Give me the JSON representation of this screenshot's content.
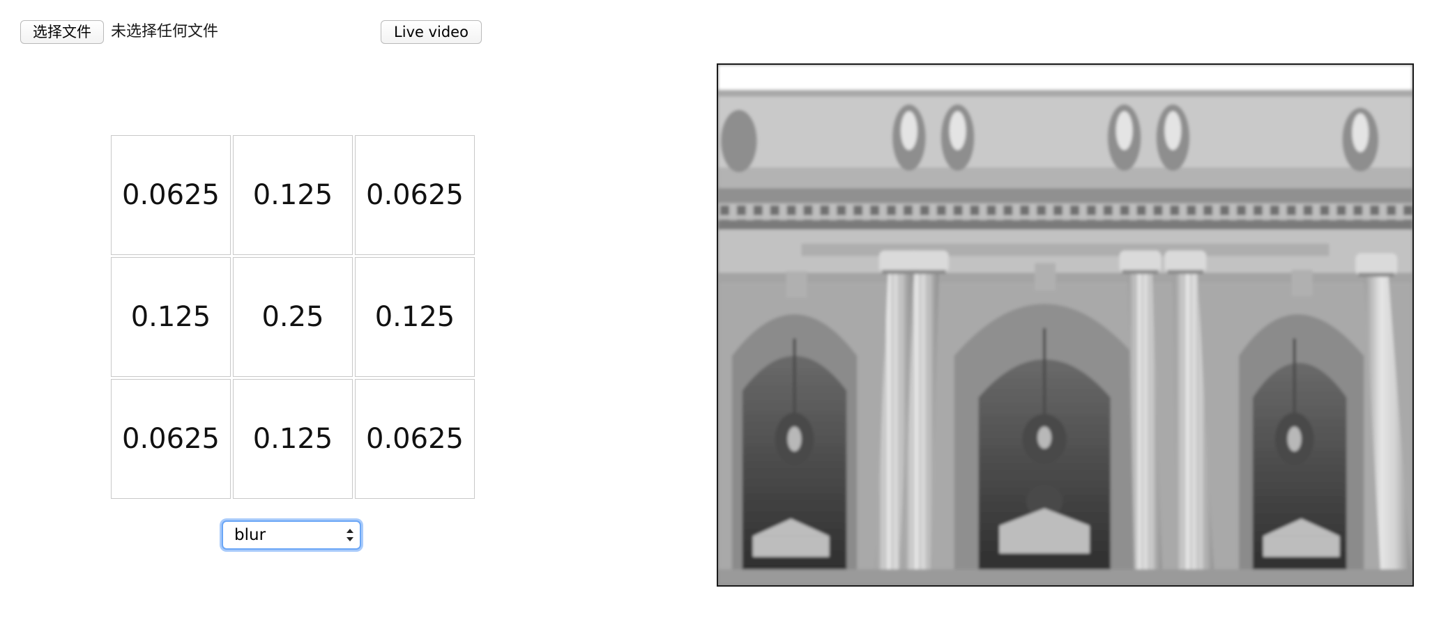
{
  "file_input": {
    "button_label": "选择文件",
    "status_text": "未选择任何文件"
  },
  "live_video": {
    "button_label": "Live video"
  },
  "kernel": {
    "rows": [
      [
        "0.0625",
        "0.125",
        "0.0625"
      ],
      [
        "0.125",
        "0.25",
        "0.125"
      ],
      [
        "0.0625",
        "0.125",
        "0.0625"
      ]
    ]
  },
  "filter_select": {
    "selected": "blur"
  },
  "output_canvas": {
    "content": "blurred grayscale photo of a neoclassical building facade with columns and arches"
  }
}
